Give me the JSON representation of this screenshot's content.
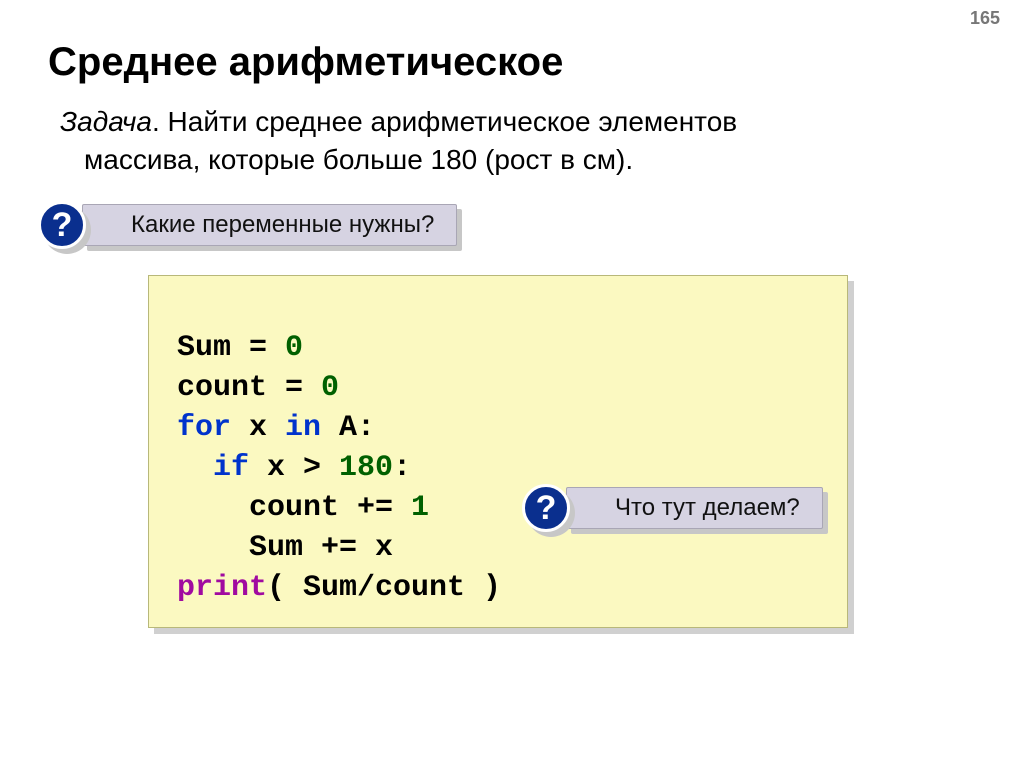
{
  "page_number": "165",
  "title": "Среднее арифметическое",
  "task": {
    "label": "Задача",
    "line1": ". Найти среднее арифметическое элементов",
    "line2": "массива, которые больше 180 (рост в см)."
  },
  "callout1": {
    "icon": "?",
    "text": "Какие переменные нужны?"
  },
  "code": {
    "l1a": "Sum = ",
    "l1b": "0",
    "l2a": "count = ",
    "l2b": "0",
    "l3a": "for",
    "l3b": " x ",
    "l3c": "in",
    "l3d": " A:",
    "l4a": "  ",
    "l4b": "if",
    "l4c": " x > ",
    "l4d": "180",
    "l4e": ":",
    "l5": "    count += ",
    "l5b": "1",
    "l6": "    Sum += x",
    "l7a": "print",
    "l7b": "( Sum/count )"
  },
  "callout2": {
    "icon": "?",
    "text": "Что тут делаем?"
  }
}
